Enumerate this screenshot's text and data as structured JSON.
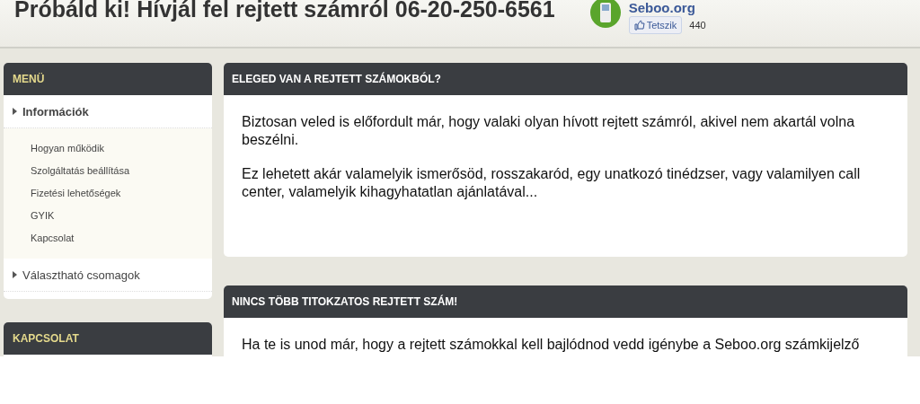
{
  "header": {
    "title": "Próbáld ki! Hívjál fel rejtett számról 06-20-250-6561",
    "site": "Seboo.org",
    "like_button": "Tetszik",
    "like_count": "440"
  },
  "sidebar": [
    {
      "kind": "menu",
      "title": "MENÜ",
      "items": [
        {
          "label": "Információk",
          "selected": true,
          "children": [
            {
              "label": "Hogyan működik"
            },
            {
              "label": "Szolgáltatás beállítása"
            },
            {
              "label": "Fizetési lehetőségek"
            },
            {
              "label": "GYIK"
            },
            {
              "label": "Kapcsolat"
            }
          ]
        },
        {
          "label": "Választható csomagok",
          "selected": false
        }
      ]
    },
    {
      "kind": "contact",
      "title": "KAPCSOLAT"
    }
  ],
  "articles": [
    {
      "title": "ELEGED VAN A REJTETT SZÁMOKBÓL?",
      "paragraphs": [
        "Biztosan veled is előfordult már, hogy valaki olyan hívott rejtett számról, akivel nem akartál volna beszélni.",
        "Ez lehetett akár valamelyik ismerősöd, rosszakaród, egy unatkozó tinédzser, vagy valamilyen call center, valamelyik kihagyhatatlan ajánlatával..."
      ]
    },
    {
      "title": "NINCS TÖBB TITOKZATOS REJTETT SZÁM!",
      "paragraphs": [
        "Ha te is unod már, hogy a rejtett számokkal kell bajlódnod vedd igénybe a Seboo.org számkijelző"
      ]
    }
  ]
}
